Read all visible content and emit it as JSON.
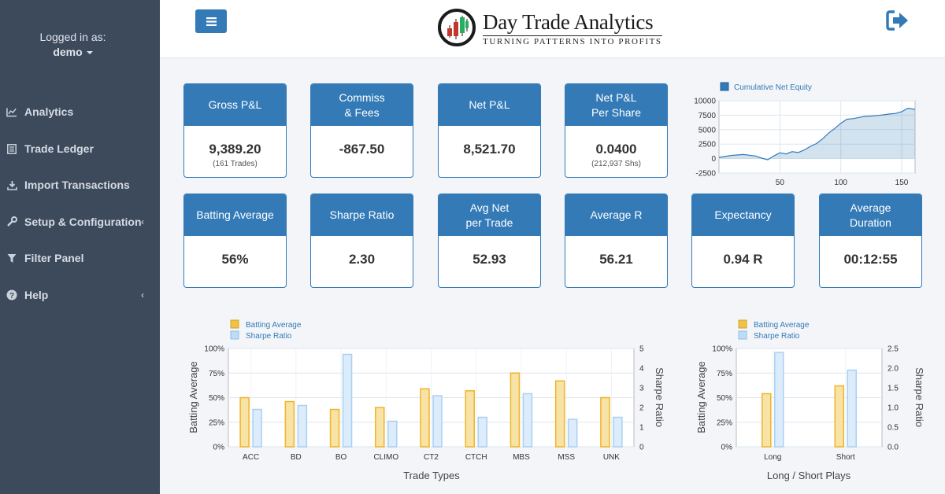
{
  "sidebar": {
    "logged_in_label": "Logged in as:",
    "username": "demo",
    "items": [
      {
        "label": "Analytics",
        "icon": "line-chart-icon"
      },
      {
        "label": "Trade Ledger",
        "icon": "ledger-icon"
      },
      {
        "label": "Import Transactions",
        "icon": "download-icon"
      },
      {
        "label": "Setup & Configuration",
        "icon": "wrench-icon",
        "chevron": "‹"
      },
      {
        "label": "Filter Panel",
        "icon": "filter-icon"
      },
      {
        "label": "Help",
        "icon": "question-icon",
        "chevron": "‹"
      }
    ]
  },
  "header": {
    "title": "Day Trade Analytics",
    "tagline": "TURNING PATTERNS INTO PROFITS",
    "accent": "#337ab7"
  },
  "stats": [
    {
      "label": "Gross P&L",
      "value": "9,389.20",
      "sub": "(161 Trades)"
    },
    {
      "label": "Commiss\n& Fees",
      "value": "-867.50",
      "sub": ""
    },
    {
      "label": "Net P&L",
      "value": "8,521.70",
      "sub": ""
    },
    {
      "label": "Net P&L\nPer Share",
      "value": "0.0400",
      "sub": "(212,937 Shs)"
    },
    {
      "label": "Batting Average",
      "value": "56%",
      "sub": ""
    },
    {
      "label": "Sharpe Ratio",
      "value": "2.30",
      "sub": ""
    },
    {
      "label": "Avg Net\nper Trade",
      "value": "52.93",
      "sub": ""
    },
    {
      "label": "Average R",
      "value": "56.21",
      "sub": ""
    },
    {
      "label": "Expectancy",
      "value": "0.94 R",
      "sub": ""
    },
    {
      "label": "Average\nDuration",
      "value": "00:12:55",
      "sub": ""
    }
  ],
  "chart_data": [
    {
      "type": "area",
      "legend": [
        "Cumulative Net Equity"
      ],
      "ylim": [
        -2500,
        10000
      ],
      "yticks": [
        "10000",
        "7500",
        "5000",
        "2500",
        "0",
        "-2500"
      ],
      "xticks": [
        "50",
        "100",
        "150"
      ],
      "xlim": [
        0,
        161
      ],
      "x": [
        0,
        10,
        20,
        30,
        35,
        40,
        45,
        50,
        55,
        60,
        65,
        70,
        75,
        80,
        85,
        90,
        95,
        100,
        105,
        110,
        115,
        120,
        125,
        130,
        135,
        140,
        145,
        150,
        155,
        161
      ],
      "y": [
        200,
        550,
        700,
        450,
        80,
        -200,
        450,
        1000,
        800,
        1200,
        1050,
        1500,
        2100,
        2600,
        3400,
        4400,
        5200,
        6100,
        6800,
        6900,
        7100,
        7300,
        7350,
        7450,
        7550,
        7700,
        7800,
        8100,
        8700,
        8500
      ],
      "color": "#337ab7"
    },
    {
      "type": "bar",
      "legend": [
        "Batting Average",
        "Sharpe Ratio"
      ],
      "xlabel": "Trade Types",
      "ylabel": "Batting Average",
      "y2label": "Sharpe Ratio",
      "categories": [
        "ACC",
        "BD",
        "BO",
        "CLIMO",
        "CT2",
        "CTCH",
        "MBS",
        "MSS",
        "UNK"
      ],
      "series": [
        {
          "name": "Batting Average",
          "values": [
            50,
            46,
            38,
            40,
            59,
            57,
            75,
            67,
            50
          ],
          "unit": "%",
          "color": "#f0c14b"
        },
        {
          "name": "Sharpe Ratio",
          "values": [
            1.9,
            2.1,
            4.7,
            1.3,
            2.6,
            1.5,
            2.7,
            1.4,
            1.5
          ],
          "color": "#bfdcf7"
        }
      ],
      "ylim": [
        0,
        100
      ],
      "y2lim": [
        0,
        5
      ],
      "yticks": [
        "100%",
        "75%",
        "50%",
        "25%",
        "0%"
      ],
      "y2ticks": [
        "5",
        "4",
        "3",
        "2",
        "1",
        "0"
      ]
    },
    {
      "type": "bar",
      "legend": [
        "Batting Average",
        "Sharpe Ratio"
      ],
      "xlabel": "Long / Short Plays",
      "ylabel": "Batting Average",
      "y2label": "Sharpe Ratio",
      "categories": [
        "Long",
        "Short"
      ],
      "series": [
        {
          "name": "Batting Average",
          "values": [
            54,
            62
          ],
          "unit": "%",
          "color": "#f0c14b"
        },
        {
          "name": "Sharpe Ratio",
          "values": [
            2.4,
            1.95
          ],
          "color": "#bfdcf7"
        }
      ],
      "ylim": [
        0,
        100
      ],
      "y2lim": [
        0,
        2.5
      ],
      "yticks": [
        "100%",
        "75%",
        "50%",
        "25%",
        "0%"
      ],
      "y2ticks": [
        "2.5",
        "2.0",
        "1.5",
        "1.0",
        "0.5",
        "0.0"
      ]
    }
  ]
}
